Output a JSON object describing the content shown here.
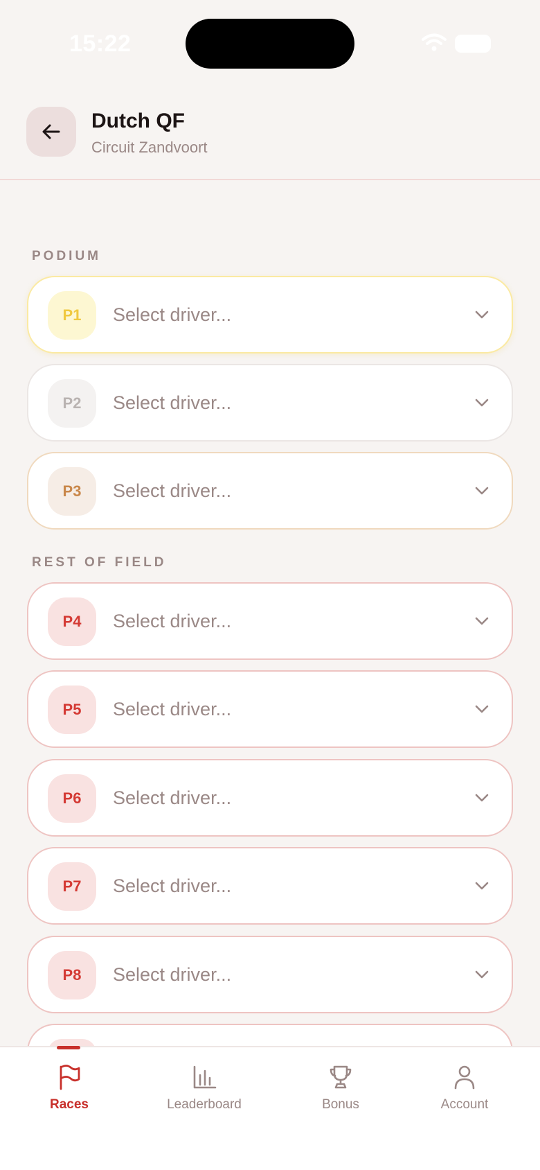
{
  "status_bar": {
    "time": "15:22"
  },
  "header": {
    "title": "Dutch QF",
    "subtitle": "Circuit Zandvoort"
  },
  "podium": {
    "label": "PODIUM",
    "rows": [
      {
        "position": "P1",
        "placeholder": "Select driver..."
      },
      {
        "position": "P2",
        "placeholder": "Select driver..."
      },
      {
        "position": "P3",
        "placeholder": "Select driver..."
      }
    ]
  },
  "rest": {
    "label": "REST OF FIELD",
    "rows": [
      {
        "position": "P4",
        "placeholder": "Select driver..."
      },
      {
        "position": "P5",
        "placeholder": "Select driver..."
      },
      {
        "position": "P6",
        "placeholder": "Select driver..."
      },
      {
        "position": "P7",
        "placeholder": "Select driver..."
      },
      {
        "position": "P8",
        "placeholder": "Select driver..."
      }
    ]
  },
  "tabs": [
    {
      "label": "Races",
      "icon": "flag-icon",
      "active": true
    },
    {
      "label": "Leaderboard",
      "icon": "bar-chart-icon",
      "active": false
    },
    {
      "label": "Bonus",
      "icon": "trophy-icon",
      "active": false
    },
    {
      "label": "Account",
      "icon": "user-icon",
      "active": false
    }
  ],
  "colors": {
    "accent": "#c8302b",
    "background": "#f7f4f2",
    "gold": "#f0c940",
    "silver": "#b9b3b1",
    "bronze": "#c9874a"
  }
}
